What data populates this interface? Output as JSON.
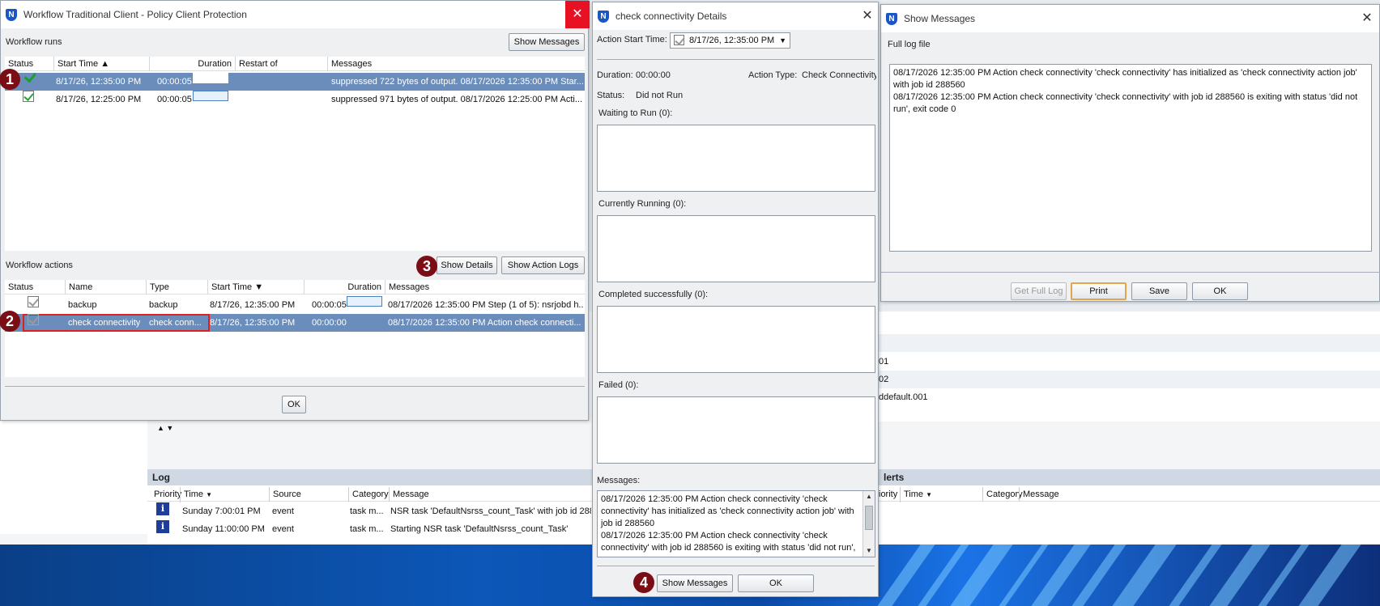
{
  "workflow_window": {
    "title": "Workflow Traditional Client - Policy Client Protection",
    "runs_label": "Workflow runs",
    "show_messages_button": "Show Messages",
    "runs_columns": [
      "Status",
      "Start Time",
      "Duration",
      "Restart of",
      "Messages"
    ],
    "runs": [
      {
        "start": "8/17/26, 12:35:00 PM",
        "duration": "00:00:05",
        "message": "suppressed 722 bytes of output. 08/17/2026 12:35:00 PM Star..."
      },
      {
        "start": "8/17/26, 12:25:00 PM",
        "duration": "00:00:05",
        "message": "suppressed 971 bytes of output. 08/17/2026 12:25:00 PM Acti..."
      }
    ],
    "actions_label": "Workflow actions",
    "show_details_button": "Show Details",
    "show_action_logs_button": "Show Action Logs",
    "actions_columns": [
      "Status",
      "Name",
      "Type",
      "Start Time",
      "Duration",
      "Messages"
    ],
    "actions": [
      {
        "name": "backup",
        "type": "backup",
        "start": "8/17/26, 12:35:00 PM",
        "duration": "00:00:05",
        "message": "08/17/2026 12:35:00 PM Step (1 of 5): nsrjobd h..."
      },
      {
        "name": "check connectivity",
        "type": "check conn...",
        "start": "8/17/26, 12:35:00 PM",
        "duration": "00:00:00",
        "message": "08/17/2026 12:35:00 PM Action check connecti..."
      }
    ],
    "ok_button": "OK"
  },
  "details_window": {
    "title": "check connectivity Details",
    "action_start_time_label": "Action Start Time:",
    "action_start_time_value": "8/17/26, 12:35:00 PM",
    "duration_label": "Duration:",
    "duration_value": "00:00:00",
    "action_type_label": "Action Type:",
    "action_type_value": "Check Connectivity",
    "status_label": "Status:",
    "status_value": "Did not Run",
    "waiting_label": "Waiting to Run (0):",
    "running_label": "Currently Running (0):",
    "completed_label": "Completed successfully (0):",
    "failed_label": "Failed (0):",
    "messages_label": "Messages:",
    "messages_text": "08/17/2026 12:35:00 PM Action check connectivity 'check connectivity' has initialized as 'check connectivity action job' with job id 288560\n08/17/2026 12:35:00 PM Action check connectivity 'check connectivity' with job id 288560 is exiting with status 'did not run',",
    "show_messages_button": "Show Messages",
    "ok_button": "OK"
  },
  "messages_window": {
    "title": "Show Messages",
    "full_log_label": "Full log file",
    "log_text": "08/17/2026 12:35:00 PM Action check connectivity 'check connectivity' has initialized as 'check connectivity action job' with job id 288560\n08/17/2026 12:35:00 PM Action check connectivity 'check connectivity' with job id 288560 is exiting with status 'did not run', exit code 0",
    "get_full_log_button": "Get Full Log",
    "print_button": "Print",
    "save_button": "Save",
    "ok_button": "OK"
  },
  "background": {
    "partial_rows": [
      "01",
      "02",
      "ddefault.001"
    ],
    "log_panel_title": "Log",
    "log_columns": [
      "Priority",
      "Time",
      "Source",
      "Category",
      "Message"
    ],
    "log_rows": [
      {
        "time": "Sunday 7:00:01 PM",
        "source": "event",
        "category": "task m...",
        "message": "NSR task 'DefaultNsrss_count_Task' with job id 288"
      },
      {
        "time": "Sunday 11:00:00 PM",
        "source": "event",
        "category": "task m...",
        "message": "Starting NSR task 'DefaultNsrss_count_Task'"
      }
    ],
    "alerts_title": "lerts",
    "alerts_columns": [
      "iority",
      "Time",
      "Category",
      "Message"
    ]
  },
  "annotations": [
    "1",
    "2",
    "3",
    "4"
  ],
  "colors": {
    "selection": "#6a8dbb",
    "badge": "#7a0e14",
    "close_red": "#e81123",
    "accent_focus": "#e0a64b"
  }
}
